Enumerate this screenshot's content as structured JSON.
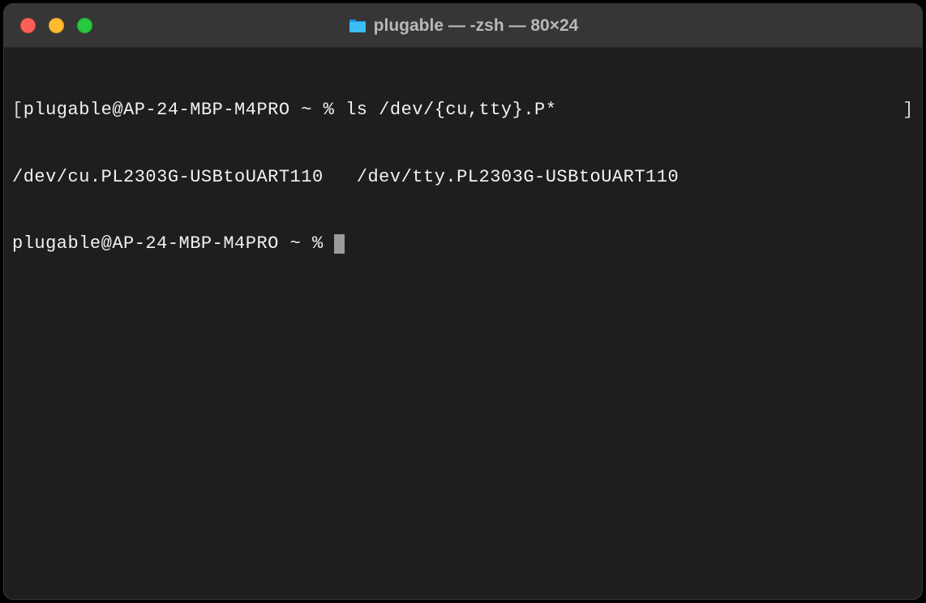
{
  "window": {
    "title": "plugable — -zsh — 80×24"
  },
  "terminal": {
    "line1": {
      "bracket_open": "[",
      "prompt": "plugable@AP-24-MBP-M4PRO ~ % ",
      "command": "ls /dev/{cu,tty}.P*",
      "bracket_close": "]"
    },
    "line2": {
      "out1": "/dev/cu.PL2303G-USBtoUART110",
      "gap": "   ",
      "out2": "/dev/tty.PL2303G-USBtoUART110"
    },
    "line3": {
      "prompt": "plugable@AP-24-MBP-M4PRO ~ % "
    }
  }
}
